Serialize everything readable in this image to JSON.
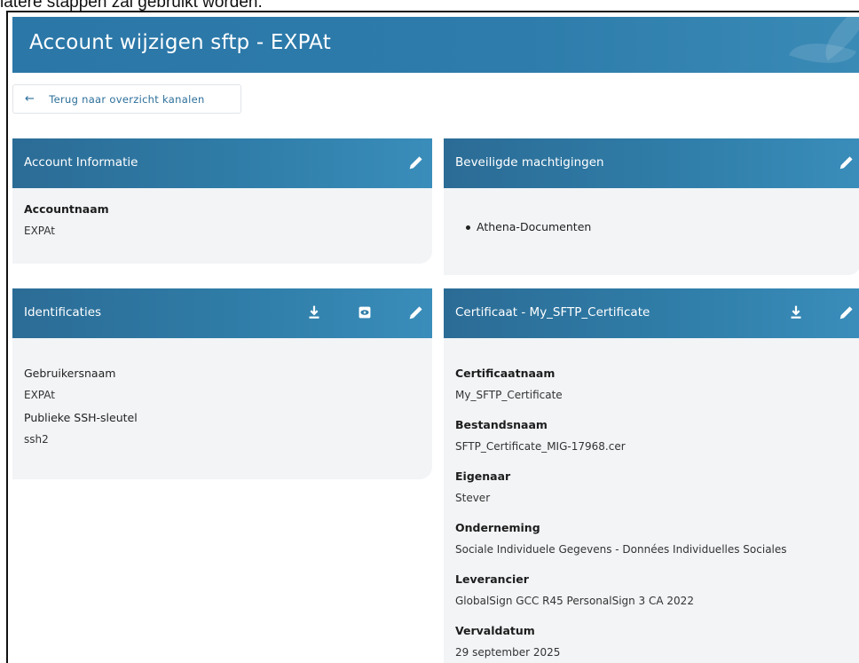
{
  "caption": "latere stappen zal gebruikt worden.",
  "page": {
    "title": "Account wijzigen sftp - EXPAt",
    "back_label": "Terug naar overzicht kanalen"
  },
  "account_info": {
    "title": "Account Informatie",
    "fields": [
      {
        "label": "Accountnaam",
        "value": "EXPAt"
      }
    ]
  },
  "permissions": {
    "title": "Beveiligde machtigingen",
    "items": [
      "Athena-Documenten"
    ]
  },
  "identifications": {
    "title": "Identificaties",
    "fields": [
      {
        "label": "Gebruikersnaam",
        "value": "EXPAt"
      },
      {
        "label": "Publieke SSH-sleutel",
        "value": "ssh2"
      }
    ]
  },
  "certificate": {
    "title": "Certificaat - My_SFTP_Certificate",
    "fields": [
      {
        "label": "Certificaatnaam",
        "value": "My_SFTP_Certificate"
      },
      {
        "label": "Bestandsnaam",
        "value": "SFTP_Certificate_MIG-17968.cer"
      },
      {
        "label": "Eigenaar",
        "value": "Stever"
      },
      {
        "label": "Onderneming",
        "value": "Sociale Individuele Gegevens - Données Individuelles Sociales"
      },
      {
        "label": "Leverancier",
        "value": "GlobalSign GCC R45 PersonalSign 3 CA 2022"
      },
      {
        "label": "Vervaldatum",
        "value": "29 september 2025"
      }
    ]
  },
  "icons": {
    "edit": "pencil-icon",
    "download": "download-icon",
    "view": "eye-icon",
    "back": "arrow-left-icon"
  },
  "colors": {
    "header_blue": "#2d7cab",
    "card_bg": "#f2f4f6",
    "link_blue": "#2c6f9a"
  }
}
